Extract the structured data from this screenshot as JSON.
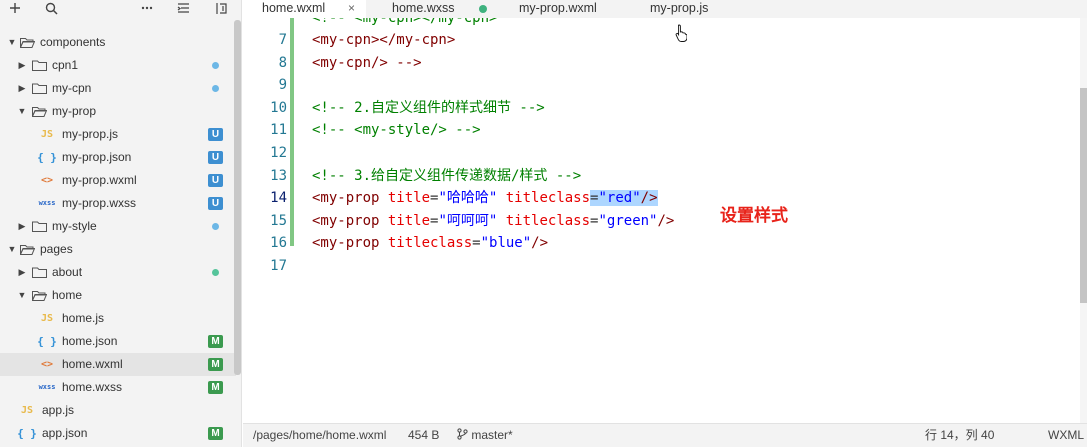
{
  "colors": {
    "git_dot_blue": "#6cb7e6",
    "git_dot_green": "#55c49a",
    "badge_blue": "#3d8fd1",
    "badge_green": "#3b9a4f",
    "annotation": "#e8231a"
  },
  "sidebar": {
    "toolbar": {
      "add_icon": "plus-icon",
      "search_icon": "search-icon",
      "more_icon": "more-icon",
      "collapse_icon": "collapse-icon",
      "split_icon": "split-icon"
    },
    "tree": [
      {
        "label": "components",
        "kind": "folder",
        "expanded": true,
        "level": 0
      },
      {
        "label": "cpn1",
        "kind": "folder",
        "expanded": false,
        "level": 1,
        "status": "dot-blue"
      },
      {
        "label": "my-cpn",
        "kind": "folder",
        "expanded": false,
        "level": 1,
        "status": "dot-blue"
      },
      {
        "label": "my-prop",
        "kind": "folder",
        "expanded": true,
        "level": 1
      },
      {
        "label": "my-prop.js",
        "kind": "js",
        "level": 2,
        "badge": "U"
      },
      {
        "label": "my-prop.json",
        "kind": "json",
        "level": 2,
        "badge": "U"
      },
      {
        "label": "my-prop.wxml",
        "kind": "wxml",
        "level": 2,
        "badge": "U"
      },
      {
        "label": "my-prop.wxss",
        "kind": "wxss",
        "level": 2,
        "badge": "U"
      },
      {
        "label": "my-style",
        "kind": "folder",
        "expanded": false,
        "level": 1,
        "status": "dot-blue"
      },
      {
        "label": "pages",
        "kind": "folder",
        "expanded": true,
        "level": 0
      },
      {
        "label": "about",
        "kind": "folder",
        "expanded": false,
        "level": 1,
        "status": "dot-green"
      },
      {
        "label": "home",
        "kind": "folder",
        "expanded": true,
        "level": 1
      },
      {
        "label": "home.js",
        "kind": "js",
        "level": 2
      },
      {
        "label": "home.json",
        "kind": "json",
        "level": 2,
        "badge": "M"
      },
      {
        "label": "home.wxml",
        "kind": "wxml",
        "level": 2,
        "badge": "M",
        "selected": true
      },
      {
        "label": "home.wxss",
        "kind": "wxss",
        "level": 2,
        "badge": "M"
      },
      {
        "label": "app.js",
        "kind": "js",
        "level": 1
      },
      {
        "label": "app.json",
        "kind": "json",
        "level": 1,
        "badge": "M"
      }
    ]
  },
  "tabs": [
    {
      "label": "home.wxml",
      "active": true,
      "close": "×"
    },
    {
      "label": "home.wxss",
      "active": false,
      "modified": true
    },
    {
      "label": "my-prop.wxml",
      "active": false
    },
    {
      "label": "my-prop.js",
      "active": false
    }
  ],
  "editor": {
    "current_line": 14,
    "partial_top": "<!-- <my-cpn></my-cpn>",
    "lines": [
      {
        "n": "7",
        "tokens": [
          [
            "tag",
            "<my-cpn></my-cpn>"
          ]
        ]
      },
      {
        "n": "8",
        "tokens": [
          [
            "tag",
            "<my-cpn/> -->"
          ]
        ]
      },
      {
        "n": "9",
        "tokens": []
      },
      {
        "n": "10",
        "tokens": [
          [
            "com",
            "<!-- 2.自定义组件的样式细节 -->"
          ]
        ]
      },
      {
        "n": "11",
        "tokens": [
          [
            "com",
            "<!-- <my-style/> -->"
          ]
        ]
      },
      {
        "n": "12",
        "tokens": []
      },
      {
        "n": "13",
        "tokens": [
          [
            "com",
            "<!-- 3.给自定义组件传递数据/样式 -->"
          ]
        ]
      },
      {
        "n": "14",
        "tokens": [
          [
            "tag",
            "<my-prop "
          ],
          [
            "attr",
            "title"
          ],
          [
            "eq",
            "="
          ],
          [
            "str",
            "\"哈哈哈\""
          ],
          [
            "eq",
            " "
          ],
          [
            "attr",
            "titleclass"
          ],
          [
            "eqh",
            "="
          ],
          [
            "strh",
            "\"red\""
          ],
          [
            "tagh",
            "/>"
          ]
        ]
      },
      {
        "n": "15",
        "tokens": [
          [
            "tag",
            "<my-prop "
          ],
          [
            "attr",
            "title"
          ],
          [
            "eq",
            "="
          ],
          [
            "str",
            "\"呵呵呵\""
          ],
          [
            "eq",
            " "
          ],
          [
            "attr",
            "titleclass"
          ],
          [
            "eq",
            "="
          ],
          [
            "str",
            "\"green\""
          ],
          [
            "tag",
            "/>"
          ]
        ]
      },
      {
        "n": "16",
        "tokens": [
          [
            "tag",
            "<my-prop "
          ],
          [
            "attr",
            "titleclass"
          ],
          [
            "eq",
            "="
          ],
          [
            "str",
            "\"blue\""
          ],
          [
            "tag",
            "/>"
          ]
        ]
      },
      {
        "n": "17",
        "tokens": []
      }
    ],
    "annotation": "设置样式"
  },
  "status": {
    "path": "/pages/home/home.wxml",
    "size": "454 B",
    "branch": "master*",
    "branch_icon": "git-branch-icon",
    "position": "行 14，列 40",
    "language": "WXML"
  }
}
